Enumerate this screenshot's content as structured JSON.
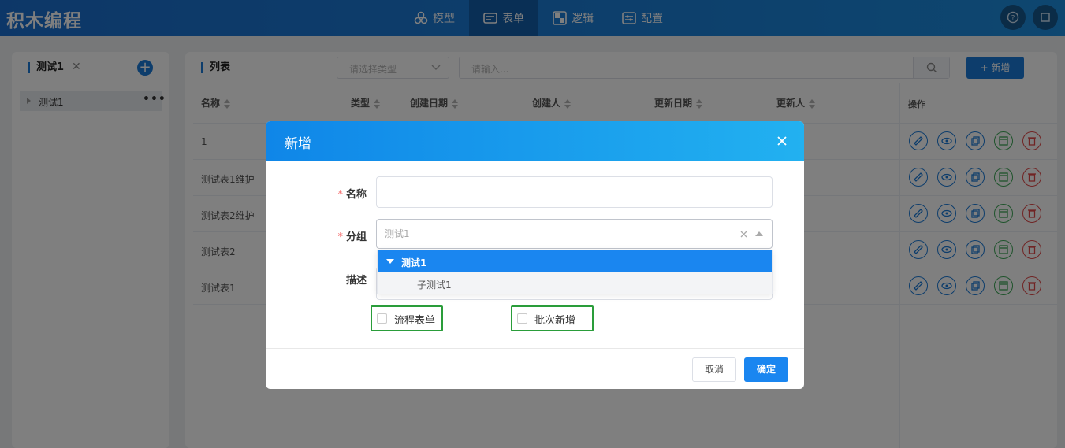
{
  "app": {
    "title": "积木编程"
  },
  "nav": [
    {
      "label": "模型",
      "icon": "model-icon"
    },
    {
      "label": "表单",
      "icon": "form-icon",
      "active": true
    },
    {
      "label": "逻辑",
      "icon": "logic-icon"
    },
    {
      "label": "配置",
      "icon": "config-icon"
    }
  ],
  "sidebar": {
    "tab_label": "测试1",
    "tree": [
      {
        "label": "测试1"
      }
    ]
  },
  "list": {
    "title": "列表",
    "type_select_placeholder": "请选择类型",
    "search_placeholder": "请输入...",
    "add_label": "+ 新增",
    "columns": [
      "名称",
      "类型",
      "创建日期",
      "创建人",
      "更新日期",
      "更新人",
      "操作"
    ],
    "rows": [
      {
        "name": "1"
      },
      {
        "name": "测试表1维护"
      },
      {
        "name": "测试表2维护"
      },
      {
        "name": "测试表2"
      },
      {
        "name": "测试表1"
      }
    ]
  },
  "modal": {
    "title": "新增",
    "name_label": "名称",
    "group_label": "分组",
    "group_value": "测试1",
    "desc_label": "描述",
    "dropdown": [
      {
        "label": "测试1",
        "level": 0,
        "selected": true
      },
      {
        "label": "子测试1",
        "level": 1
      }
    ],
    "checkbox_flow": "流程表单",
    "checkbox_batch": "批次新增",
    "cancel_label": "取消",
    "ok_label": "确定"
  },
  "colors": {
    "primary": "#1a86f0",
    "header": "#1a6fd0",
    "highlight_border": "#2a9d3a",
    "danger": "#e04848",
    "success": "#3aa655"
  }
}
